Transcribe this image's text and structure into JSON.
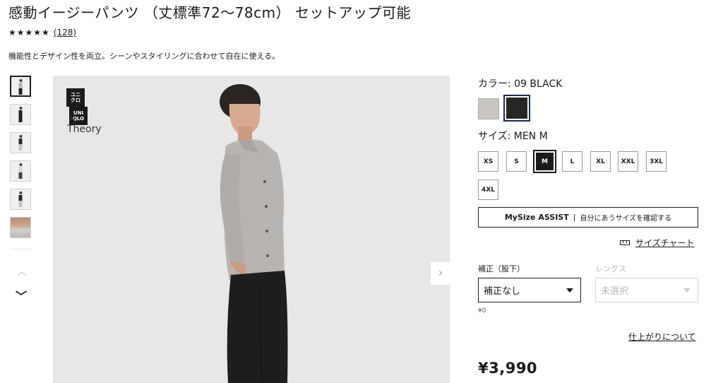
{
  "product": {
    "title": "感動イージーパンツ （丈標準72〜78cm） セットアップ可能",
    "stars": "★★★★★",
    "review_count": "(128)",
    "rating": 4.5,
    "description": "機能性とデザイン性を両立。シーンやスタイリングに合わせて自在に使える。"
  },
  "gallery": {
    "thumbnails": [
      "look-1",
      "look-2",
      "look-3",
      "look-4",
      "look-5",
      "fabric-detail"
    ],
    "selected_index": 0,
    "logo_top_left": "ユニ\nクロ",
    "logo_top_right": "UNI\nQLO",
    "logo_x": "×",
    "logo_brand": "Theory",
    "up_arrow": "︿",
    "down_arrow": "﹀",
    "next_arrow": "›"
  },
  "color": {
    "label": "カラー:  09 BLACK",
    "swatches": [
      {
        "name": "grey",
        "hex": "#c9c6c2"
      },
      {
        "name": "black",
        "hex": "#262626",
        "selected": true
      }
    ]
  },
  "size": {
    "label": "サイズ:  MEN M",
    "options": [
      "XS",
      "S",
      "M",
      "L",
      "XL",
      "XXL",
      "3XL",
      "4XL"
    ],
    "selected": "M"
  },
  "mysize": {
    "title": "MySize ASSIST",
    "divider": "|",
    "subtitle": "自分にあうサイズを確認する"
  },
  "size_chart": {
    "label": "サイズチャート",
    "icon": "ruler-icon"
  },
  "alteration": {
    "label": "補正（股下）",
    "value": "補正なし",
    "fee": "¥0"
  },
  "length": {
    "label": "レングス",
    "value": "未選択"
  },
  "finish_link": "仕上がりについて",
  "price": "¥3,990"
}
